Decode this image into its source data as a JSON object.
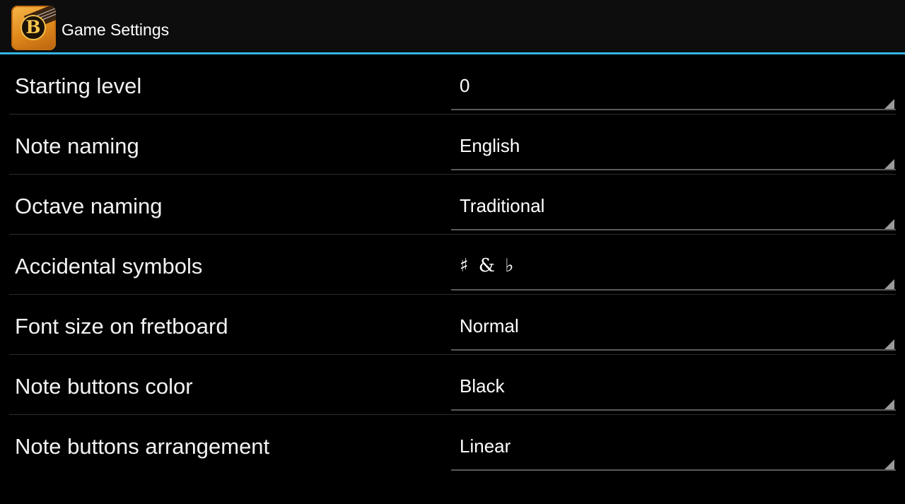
{
  "action_bar": {
    "title": "Game Settings",
    "icon": "app-logo-b-guitar",
    "icon_letter": "B",
    "accent_color": "#33b5e5"
  },
  "settings": [
    {
      "label": "Starting level",
      "value": "0"
    },
    {
      "label": "Note naming",
      "value": "English"
    },
    {
      "label": "Octave naming",
      "value": "Traditional"
    },
    {
      "label": "Accidental symbols",
      "value": "♯ & ♭"
    },
    {
      "label": "Font size on fretboard",
      "value": "Normal"
    },
    {
      "label": "Note buttons color",
      "value": "Black"
    },
    {
      "label": "Note buttons arrangement",
      "value": "Linear"
    }
  ]
}
